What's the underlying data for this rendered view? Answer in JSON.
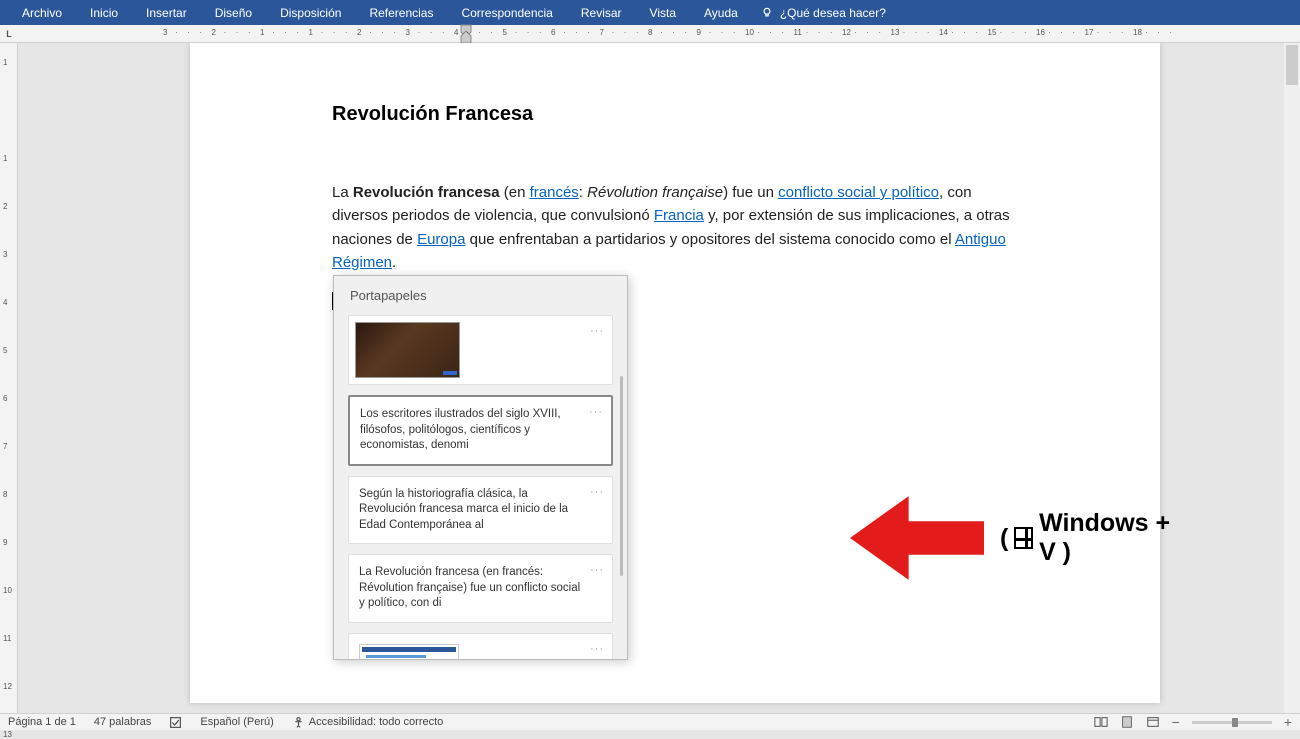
{
  "ribbon": {
    "tabs": [
      "Archivo",
      "Inicio",
      "Insertar",
      "Diseño",
      "Disposición",
      "Referencias",
      "Correspondencia",
      "Revisar",
      "Vista",
      "Ayuda"
    ],
    "tellme": "¿Qué desea hacer?"
  },
  "ruler_h": [
    "3",
    "2",
    "1",
    "1",
    "2",
    "3",
    "4",
    "5",
    "6",
    "7",
    "8",
    "9",
    "10",
    "11",
    "12",
    "13",
    "14",
    "15",
    "16",
    "17",
    "18"
  ],
  "ruler_v": [
    "1",
    "",
    "1",
    "2",
    "3",
    "4",
    "5",
    "6",
    "7",
    "8",
    "9",
    "10",
    "11",
    "12",
    "13"
  ],
  "document": {
    "title": "Revolución Francesa",
    "p1_pre": "La ",
    "p1_bold": "Revolución francesa",
    "p1_a": " (en ",
    "link_frances": "francés",
    "p1_b": ": ",
    "p1_italic": "Révolution française",
    "p1_c": ") fue un ",
    "link_conflicto": "conflicto social y político",
    "p1_d": ", con diversos periodos de violencia, que convulsionó ",
    "link_francia": "Francia",
    "p1_e": " y, por extensión de sus implicaciones, a otras naciones de ",
    "link_europa": "Europa",
    "p1_f": " que enfrentaban a partidarios y opositores del sistema conocido como el ",
    "link_antiguo": "Antiguo Régimen",
    "p1_g": "."
  },
  "clipboard": {
    "title": "Portapapeles",
    "items": [
      {
        "type": "image"
      },
      {
        "type": "text",
        "text": "Los escritores ilustrados del siglo XVIII, filósofos, politólogos, científicos y economistas, denomi"
      },
      {
        "type": "text",
        "text": "Según la historiografía clásica, la Revolución francesa marca el inicio de la Edad Contemporánea al"
      },
      {
        "type": "text",
        "text": "La Revolución francesa (en francés: Révolution française) fue un conflicto social y político, con di"
      },
      {
        "type": "screenshot"
      }
    ]
  },
  "annotation": {
    "text": "Windows + V )",
    "prefix": "("
  },
  "status": {
    "page": "Página 1 de 1",
    "words": "47 palabras",
    "lang": "Español (Perú)",
    "access": "Accesibilidad: todo correcto"
  }
}
